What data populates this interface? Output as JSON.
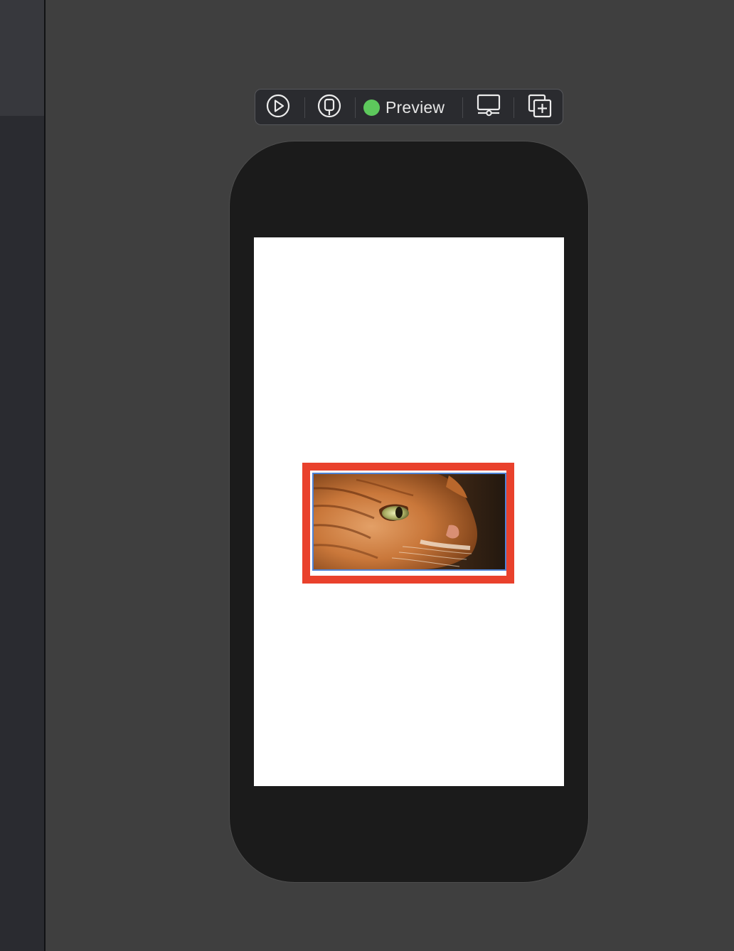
{
  "toolbar": {
    "preview_label": "Preview",
    "status_color": "#5dc85c",
    "buttons": [
      {
        "icon": "live-play-icon"
      },
      {
        "icon": "selectable-mode-icon"
      },
      {
        "icon": "device-settings-icon"
      },
      {
        "icon": "duplicate-preview-icon"
      }
    ]
  },
  "canvas": {
    "device": "iphone",
    "screen_background": "#ffffff"
  },
  "selection": {
    "outer_border_color": "#e9412c",
    "inner_border_color": "#4d82d6",
    "content": "orange-tabby-cat-photo"
  }
}
